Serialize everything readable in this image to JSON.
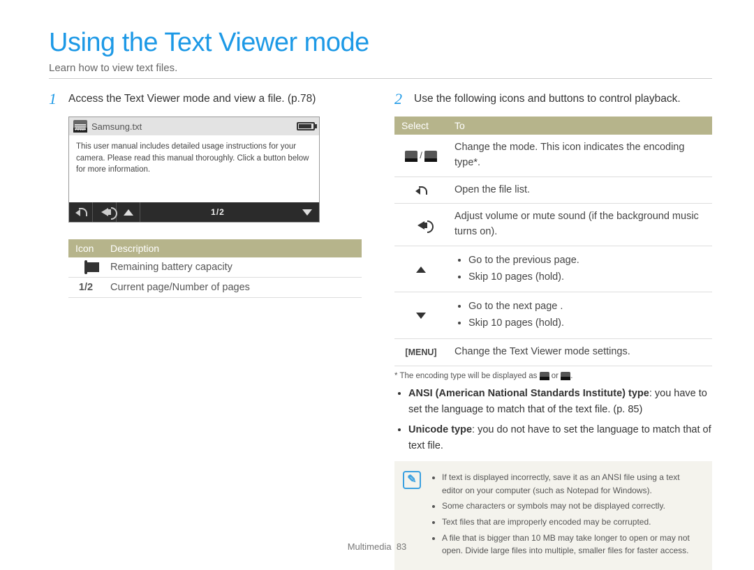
{
  "title": "Using the Text Viewer mode",
  "subtitle": "Learn how to view text files.",
  "step1": {
    "num": "1",
    "text": "Access the Text Viewer mode and view a file. (p.78)"
  },
  "step2": {
    "num": "2",
    "text": "Use the following icons and buttons to control playback."
  },
  "device": {
    "filename": "Samsung.txt",
    "body": "This user manual includes detailed usage instructions for your camera. Please read this manual thoroughly. Click a button below for more information.",
    "pager": "1/2"
  },
  "descTable": {
    "head_icon": "Icon",
    "head_desc": "Description",
    "rows": [
      {
        "icon": "battery",
        "desc": "Remaining battery capacity"
      },
      {
        "icon_text": "1/2",
        "desc": "Current page/Number of pages"
      }
    ]
  },
  "selTable": {
    "head_sel": "Select",
    "head_to": "To",
    "rows": [
      {
        "sel": "encoding-pair",
        "to": "Change the mode. This icon indicates the encoding type*."
      },
      {
        "sel": "back",
        "to": "Open the file list."
      },
      {
        "sel": "speaker",
        "to": "Adjust volume or mute sound (if the background music turns on)."
      },
      {
        "sel": "up",
        "to_list": [
          "Go to the previous page.",
          "Skip 10 pages (hold)."
        ]
      },
      {
        "sel": "down",
        "to_list": [
          "Go to the next page .",
          "Skip 10 pages (hold)."
        ]
      },
      {
        "sel_text": "[MENU]",
        "to": "Change the Text Viewer mode settings."
      }
    ]
  },
  "footnote_pre": "* The encoding type will be displayed as ",
  "footnote_mid": " or ",
  "footnote_post": ".",
  "body_bullets": [
    {
      "bold": "ANSI (American National Standards Institute) type",
      "rest": ": you have to set the language to match that of the text file. (p. 85)"
    },
    {
      "bold": "Unicode type",
      "rest": ": you do not have to set the language to match that of text file."
    }
  ],
  "info_notes": [
    "If text is displayed incorrectly, save it as an ANSI file using a text editor on your computer (such as Notepad for Windows).",
    "Some characters or symbols may not be displayed correctly.",
    "Text files that are improperly encoded may be corrupted.",
    "A file that is bigger than 10 MB may take longer to open or may not open. Divide large files into multiple, smaller files for faster access."
  ],
  "footer_section": "Multimedia",
  "footer_page": "83"
}
